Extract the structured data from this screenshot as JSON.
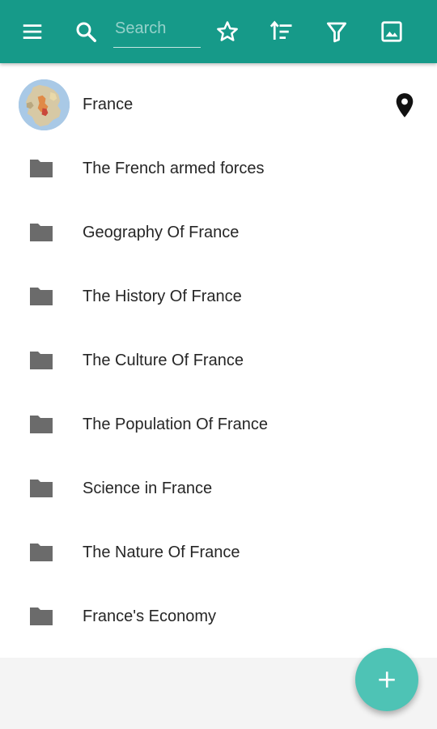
{
  "toolbar": {
    "bg_color": "#169a89",
    "menu_icon": "menu-icon",
    "search_icon": "search-icon",
    "search_placeholder": "Search",
    "search_value": "",
    "favorites_icon": "star-outline-icon",
    "sort_icon": "sort-icon",
    "filter_icon": "filter-icon",
    "image_icon": "image-icon"
  },
  "header_item": {
    "label": "France",
    "thumbnail": "europe-map-thumbnail",
    "location_icon": "map-pin-icon"
  },
  "folders": [
    {
      "label": "The French armed forces",
      "icon": "folder-icon"
    },
    {
      "label": "Geography Of France",
      "icon": "folder-icon"
    },
    {
      "label": "The History Of France",
      "icon": "folder-icon"
    },
    {
      "label": "The Culture Of France",
      "icon": "folder-icon"
    },
    {
      "label": "The Population Of France",
      "icon": "folder-icon"
    },
    {
      "label": "Science in France",
      "icon": "folder-icon"
    },
    {
      "label": "The Nature Of France",
      "icon": "folder-icon"
    },
    {
      "label": "France's Economy",
      "icon": "folder-icon"
    }
  ],
  "fab": {
    "icon": "plus-icon",
    "color": "#4ec3b5"
  },
  "colors": {
    "folder": "#6b6b6b",
    "text": "#262626"
  }
}
